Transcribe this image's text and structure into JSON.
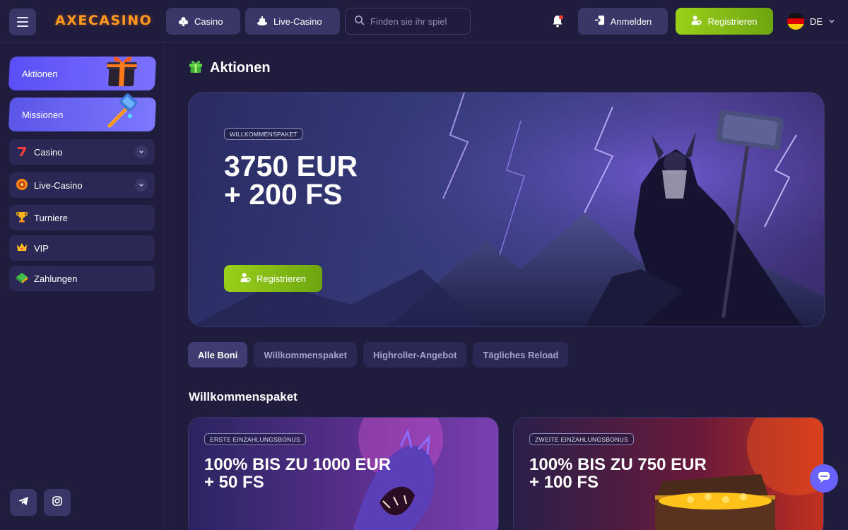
{
  "header": {
    "logo": "AXECASINO",
    "casino_label": "Casino",
    "live_casino_label": "Live-Casino",
    "search_placeholder": "Finden sie ihr spiel",
    "login_label": "Anmelden",
    "register_label": "Registrieren",
    "language": "DE"
  },
  "sidebar": {
    "promos": [
      {
        "label": "Aktionen"
      },
      {
        "label": "Missionen"
      }
    ],
    "items": [
      {
        "label": "Casino",
        "expandable": true
      },
      {
        "label": "Live-Casino",
        "expandable": true
      },
      {
        "label": "Turniere",
        "expandable": false
      },
      {
        "label": "VIP",
        "expandable": false
      },
      {
        "label": "Zahlungen",
        "expandable": false
      }
    ],
    "social": [
      "telegram-icon",
      "instagram-icon"
    ]
  },
  "main": {
    "title": "Aktionen",
    "hero": {
      "badge": "WILLKOMMENSPAKET",
      "title_line1": "3750 EUR",
      "title_line2": "+ 200 FS",
      "cta": "Registrieren"
    },
    "filters": [
      {
        "label": "Alle Boni",
        "active": true
      },
      {
        "label": "Willkommenspaket",
        "active": false
      },
      {
        "label": "Highroller-Angebot",
        "active": false
      },
      {
        "label": "Tägliches Reload",
        "active": false
      }
    ],
    "section_title": "Willkommenspaket",
    "cards": [
      {
        "badge": "ERSTE EINZAHLUNGSBONUS",
        "title_line1": "100% BIS ZU 1000 EUR",
        "title_line2": "+ 50 FS"
      },
      {
        "badge": "ZWEITE EINZAHLUNGSBONUS",
        "title_line1": "100% BIS ZU 750 EUR",
        "title_line2": "+ 100 FS"
      }
    ]
  },
  "colors": {
    "background": "#1f1c3d",
    "panel": "#2c2856",
    "button": "#3a3668",
    "accent_green": "#9ad01a",
    "accent_purple": "#5a4ff5",
    "logo_orange": "#ff9a1f"
  }
}
